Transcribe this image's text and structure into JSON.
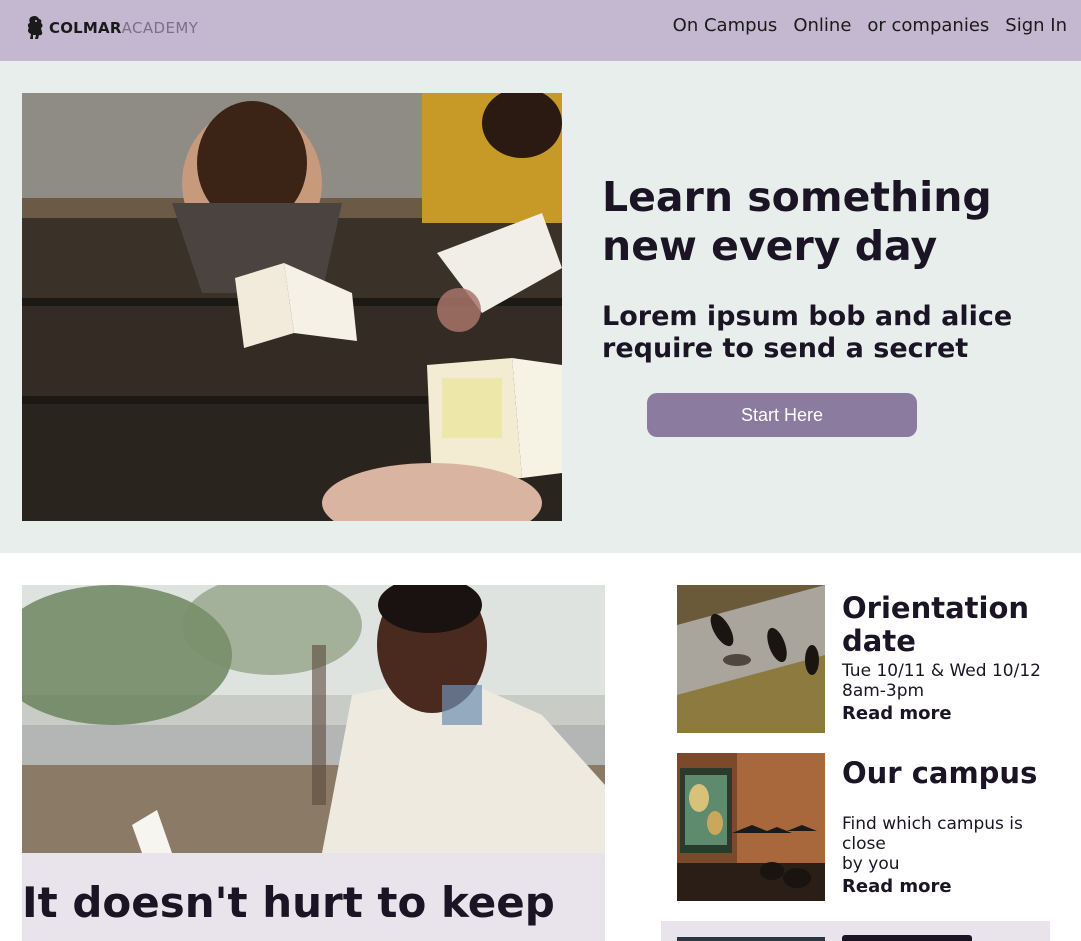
{
  "header": {
    "logo_bold": "COLMAR",
    "logo_light": "ACADEMY",
    "nav": [
      "On Campus",
      "Online",
      "or companies",
      "Sign In"
    ]
  },
  "hero": {
    "title_line1": "Learn something",
    "title_line2": "new every day",
    "subtitle_line1": "Lorem ipsum bob and alice",
    "subtitle_line2": "require to send a secret",
    "cta_label": "Start Here"
  },
  "feature": {
    "title": "It doesn't hurt to keep"
  },
  "cards": [
    {
      "title_line1": "Orientation",
      "title_line2": "date",
      "line1": "Tue 10/11 & Wed 10/12",
      "line2": "8am-3pm",
      "link": "Read more"
    },
    {
      "title": "Our campus",
      "line1": "Find which campus is close",
      "line2": "by you",
      "link": "Read more"
    }
  ],
  "colors": {
    "header_bg": "#c3b8d0",
    "hero_bg": "#e8eeec",
    "accent": "#8b7b9f",
    "panel_bg": "#e9e4ec"
  }
}
